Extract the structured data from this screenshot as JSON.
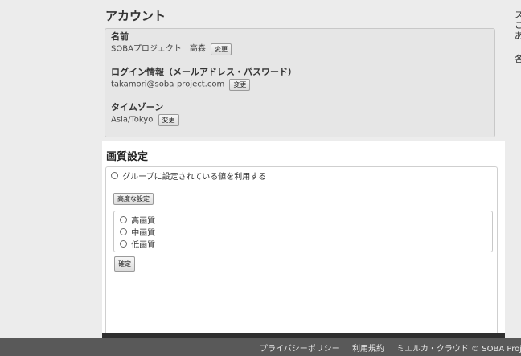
{
  "account": {
    "title": "アカウント",
    "name": {
      "label": "名前",
      "value": "SOBAプロジェクト　高森",
      "button": "変更"
    },
    "login": {
      "label": "ログイン情報（メールアドレス・パスワード）",
      "value": "takamori@soba-project.com",
      "button": "変更"
    },
    "timezone": {
      "label": "タイムゾーン",
      "value": "Asia/Tokyo",
      "button": "変更"
    }
  },
  "right_panel": {
    "lines": [
      "ス",
      "こ",
      "あ",
      "各"
    ]
  },
  "quality": {
    "title": "画質設定",
    "group_option": "グループに設定されている値を利用する",
    "advanced_button": "高度な設定",
    "options": [
      "高画質",
      "中画質",
      "低画質"
    ],
    "confirm_button": "確定"
  },
  "footer": {
    "privacy": "プライバシーポリシー",
    "terms": "利用規約",
    "copyright": "ミエルカ・クラウド © SOBA Projec"
  }
}
